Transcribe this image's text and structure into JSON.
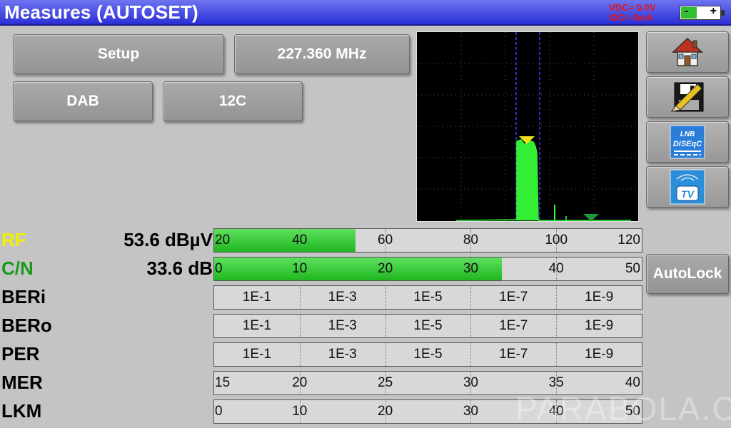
{
  "header": {
    "title": "Measures (AUTOSET)",
    "vdc": "VDC= 0.0V",
    "idc": "IDC= 0mA",
    "battery": {
      "minus": "-",
      "plus": "+",
      "level": 0.4
    }
  },
  "buttons": {
    "setup": "Setup",
    "frequency": "227.360 MHz",
    "standard": "DAB",
    "channel": "12C",
    "autolock": "AutoLock"
  },
  "side_icons": [
    "home-icon",
    "save-icon",
    "lnb-diseqc-icon",
    "tv-icon"
  ],
  "lnb_icon_text": {
    "line1": "LNB",
    "line2": "DiSEqC"
  },
  "tv_icon_text": "TV",
  "measures": [
    {
      "label": "RF",
      "value": "53.6 dBµV",
      "color": "#f0f000",
      "fill": 0.33,
      "ticks": [
        "20",
        "40",
        "60",
        "80",
        "100",
        "120"
      ],
      "tickpos": [
        0,
        0.2,
        0.4,
        0.6,
        0.8,
        1.0
      ],
      "labelpos": "left"
    },
    {
      "label": "C/N",
      "value": "33.6 dB",
      "color": "#1a9a1a",
      "fill": 0.672,
      "ticks": [
        "0",
        "10",
        "20",
        "30",
        "40",
        "50"
      ],
      "tickpos": [
        0,
        0.2,
        0.4,
        0.6,
        0.8,
        1.0
      ],
      "labelpos": "left"
    },
    {
      "label": "BERi",
      "value": "",
      "color": "#000000",
      "fill": 0,
      "ticks": [
        "1E-1",
        "1E-3",
        "1E-5",
        "1E-7",
        "1E-9"
      ],
      "tickpos": [
        0.1,
        0.3,
        0.5,
        0.7,
        0.9
      ],
      "labelpos": "center"
    },
    {
      "label": "BERo",
      "value": "",
      "color": "#000000",
      "fill": 0,
      "ticks": [
        "1E-1",
        "1E-3",
        "1E-5",
        "1E-7",
        "1E-9"
      ],
      "tickpos": [
        0.1,
        0.3,
        0.5,
        0.7,
        0.9
      ],
      "labelpos": "center"
    },
    {
      "label": "PER",
      "value": "",
      "color": "#000000",
      "fill": 0,
      "ticks": [
        "1E-1",
        "1E-3",
        "1E-5",
        "1E-7",
        "1E-9"
      ],
      "tickpos": [
        0.1,
        0.3,
        0.5,
        0.7,
        0.9
      ],
      "labelpos": "center"
    },
    {
      "label": "MER",
      "value": "",
      "color": "#000000",
      "fill": 0,
      "ticks": [
        "15",
        "20",
        "25",
        "30",
        "35",
        "40"
      ],
      "tickpos": [
        0,
        0.2,
        0.4,
        0.6,
        0.8,
        1.0
      ],
      "labelpos": "left"
    },
    {
      "label": "LKM",
      "value": "",
      "color": "#000000",
      "fill": 0,
      "ticks": [
        "0",
        "10",
        "20",
        "30",
        "40",
        "50"
      ],
      "tickpos": [
        0,
        0.2,
        0.4,
        0.6,
        0.8,
        1.0
      ],
      "labelpos": "left"
    }
  ],
  "colors": {
    "title_bar": "#2a2fd6",
    "spectrum_signal": "#33ff33",
    "marker": "#f0e020",
    "channel_lines": "#3a3aff"
  },
  "watermark": "PARABOLA.CZ"
}
